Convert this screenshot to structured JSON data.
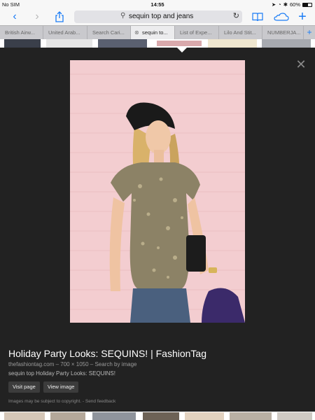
{
  "status_bar": {
    "carrier": "No SIM",
    "time": "14:55",
    "battery": "60%"
  },
  "toolbar": {
    "search_query": "sequin top and jeans",
    "icons": [
      "back-icon",
      "forward-icon",
      "share-icon",
      "search-icon",
      "reload-icon",
      "bookmarks-icon",
      "cloud-tabs-icon",
      "new-tab-icon"
    ]
  },
  "tabs": [
    {
      "label": "British Airw..."
    },
    {
      "label": "United Arab..."
    },
    {
      "label": "Search Cari..."
    },
    {
      "label": "sequin to...",
      "active": true
    },
    {
      "label": "List of Expe..."
    },
    {
      "label": "Lilo And Stit..."
    },
    {
      "label": "NUMBERJA..."
    }
  ],
  "result": {
    "title": "Holiday Party Looks: SEQUINS! | FashionTag",
    "source": "thefashiontag.com",
    "dimensions": "700 × 1050",
    "search_by_image": "Search by image",
    "description": "sequin top Holiday Party Looks: SEQUINS!",
    "visit_page": "Visit page",
    "view_image": "View image",
    "copyright": "Images may be subject to copyright.",
    "feedback": "Send feedback"
  },
  "colors": {
    "accent": "#1a7cf6",
    "panel_bg": "#222222",
    "photo_wall": "#f4cfd0"
  }
}
